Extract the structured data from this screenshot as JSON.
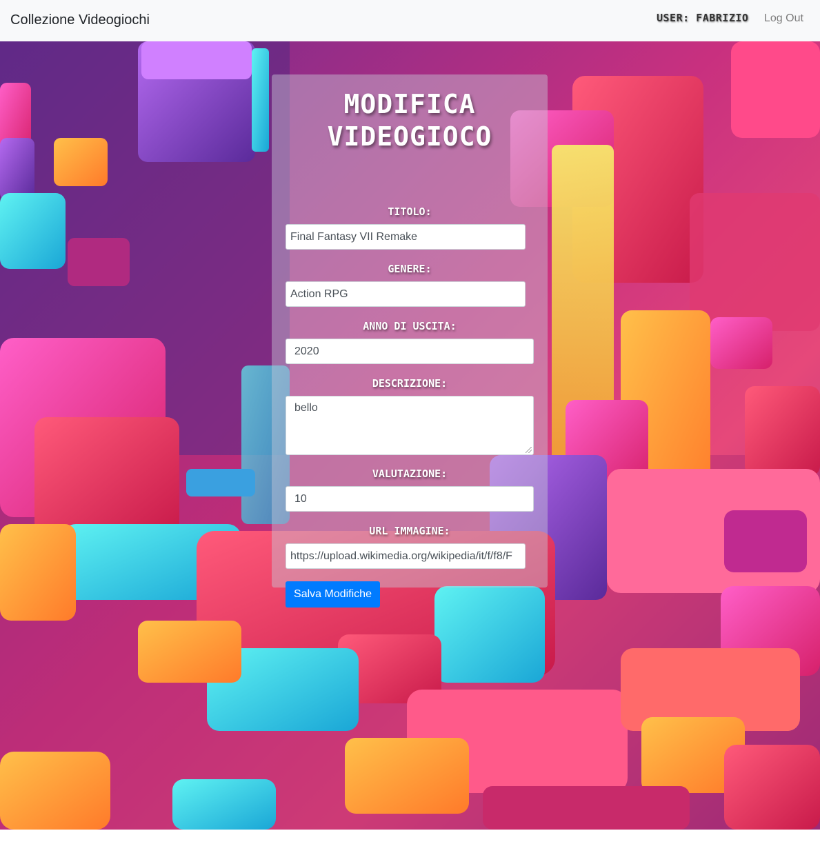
{
  "navbar": {
    "brand": "Collezione Videogiochi",
    "user": "User: Fabrizio",
    "logout": "Log Out"
  },
  "form": {
    "title": "Modifica Videogioco",
    "fields": {
      "titolo": {
        "label": "Titolo:",
        "value": "Final Fantasy VII Remake"
      },
      "genere": {
        "label": "Genere:",
        "value": "Action RPG"
      },
      "anno": {
        "label": "Anno di uscita:",
        "value": "2020"
      },
      "descrizione": {
        "label": "Descrizione:",
        "value": "bello"
      },
      "valutazione": {
        "label": "Valutazione:",
        "value": "10"
      },
      "url": {
        "label": "URL Immagine:",
        "value": "https://upload.wikimedia.org/wikipedia/it/f/f8/F"
      }
    },
    "submit_label": "Salva Modifiche"
  },
  "colors": {
    "navbar_bg": "#f8f9fa",
    "button_primary": "#007bff",
    "label_text": "#ffffff"
  }
}
